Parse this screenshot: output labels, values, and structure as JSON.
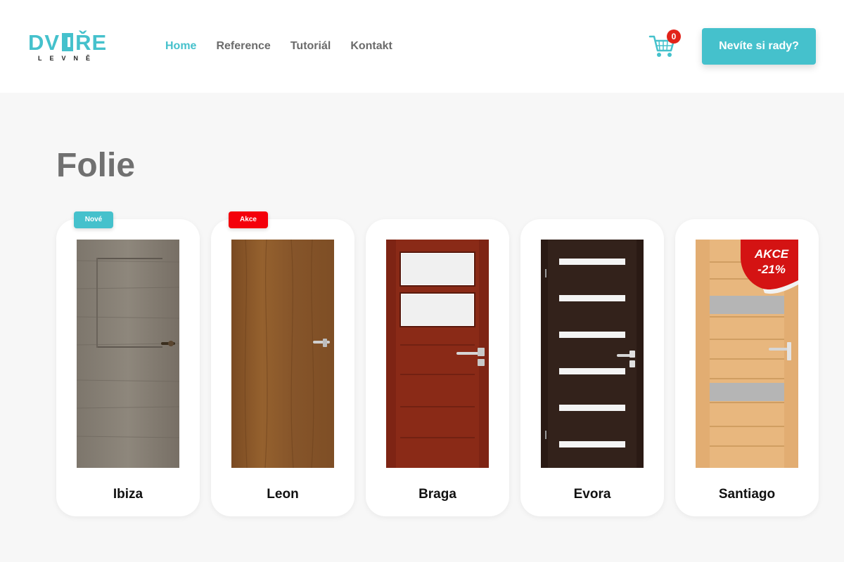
{
  "header": {
    "logo_text": "DVEŘE",
    "logo_subtext": "LEVNĚ",
    "nav": [
      {
        "label": "Home",
        "active": true
      },
      {
        "label": "Reference",
        "active": false
      },
      {
        "label": "Tutoriál",
        "active": false
      },
      {
        "label": "Kontakt",
        "active": false
      }
    ],
    "cart_count": "0",
    "cta_label": "Nevíte si rady?"
  },
  "page": {
    "title": "Folie"
  },
  "products": [
    {
      "name": "Ibiza",
      "badge": "Nové"
    },
    {
      "name": "Leon",
      "badge": "Akce"
    },
    {
      "name": "Braga",
      "badge": ""
    },
    {
      "name": "Evora",
      "badge": ""
    },
    {
      "name": "Santiago",
      "badge": "",
      "sticker_line1": "AKCE",
      "sticker_line2": "-21%"
    }
  ],
  "colors": {
    "accent": "#45c1cc",
    "sale": "#f4000b",
    "cart_badge": "#e2231a",
    "title": "#707070"
  }
}
